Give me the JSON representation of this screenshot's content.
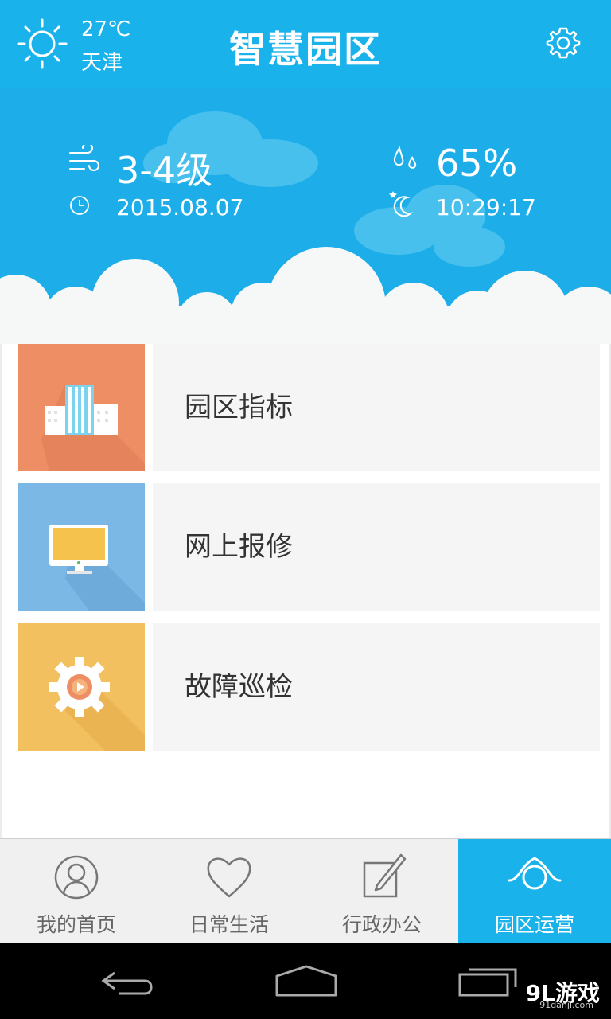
{
  "header": {
    "temperature": "27℃",
    "city": "天津",
    "title": "智慧园区"
  },
  "weather": {
    "wind_level": "3-4级",
    "date": "2015.08.07",
    "humidity": "65%",
    "time": "10:29:17"
  },
  "menu": {
    "items": [
      {
        "label": "园区指标",
        "icon": "buildings-icon",
        "color": "#ee8e65"
      },
      {
        "label": "网上报修",
        "icon": "monitor-icon",
        "color": "#7cb8e6"
      },
      {
        "label": "故障巡检",
        "icon": "gear-icon",
        "color": "#f3c060"
      }
    ]
  },
  "bottom_nav": {
    "items": [
      {
        "label": "我的首页",
        "icon": "user-icon"
      },
      {
        "label": "日常生活",
        "icon": "heart-icon"
      },
      {
        "label": "行政办公",
        "icon": "edit-icon"
      },
      {
        "label": "园区运营",
        "icon": "park-operation-icon",
        "active": true
      }
    ]
  },
  "watermark": {
    "brand": "9L游戏",
    "site": "91danji.com"
  },
  "colors": {
    "accent": "#1ab2ea",
    "menu_bg": "#f4f5f4"
  }
}
